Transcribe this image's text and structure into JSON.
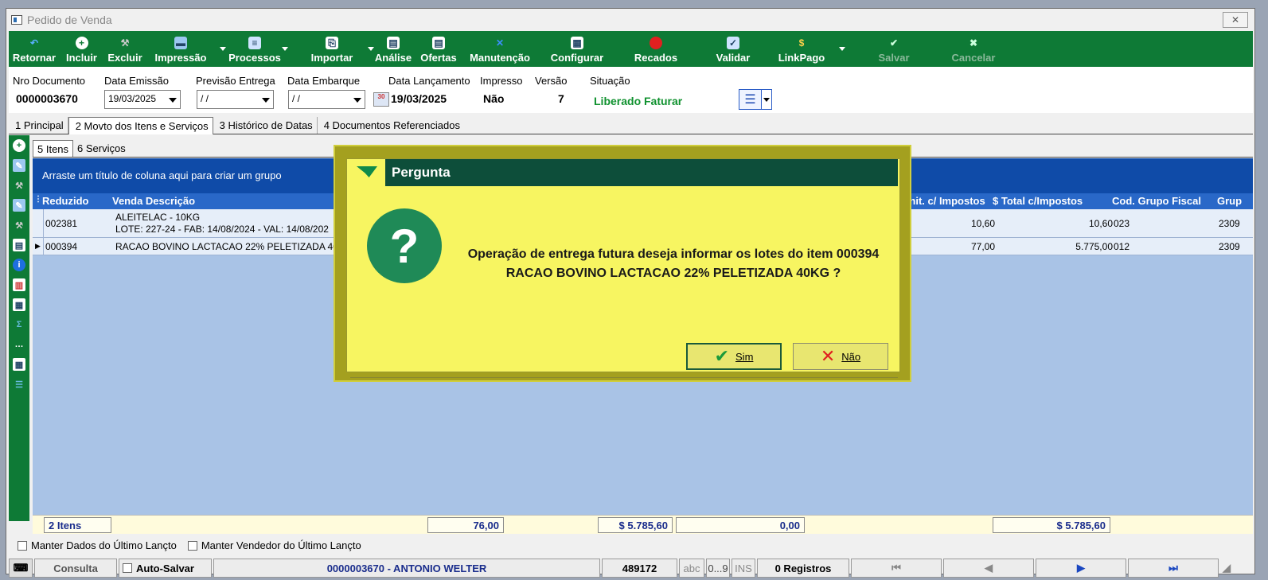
{
  "window": {
    "title": "Pedido de Venda",
    "close_icon": "close-icon"
  },
  "toolbar": {
    "items": [
      {
        "label": "Retornar",
        "icon": "return-icon"
      },
      {
        "label": "Incluir",
        "icon": "plus-icon"
      },
      {
        "label": "Excluir",
        "icon": "delete-icon"
      },
      {
        "label": "Impressão",
        "icon": "printer-icon"
      },
      {
        "label": "Processos",
        "icon": "document-icon"
      },
      {
        "label": "Importar",
        "icon": "import-icon"
      },
      {
        "label": "Análise",
        "icon": "analysis-icon"
      },
      {
        "label": "Ofertas",
        "icon": "offers-icon"
      },
      {
        "label": "Manutenção",
        "icon": "tools-icon"
      },
      {
        "label": "Configurar",
        "icon": "configure-icon"
      },
      {
        "label": "Recados",
        "icon": "message-icon"
      },
      {
        "label": "Validar",
        "icon": "validate-icon"
      },
      {
        "label": "LinkPago",
        "icon": "money-bag-icon"
      },
      {
        "label": "Salvar",
        "icon": "check-icon"
      },
      {
        "label": "Cancelar",
        "icon": "cancel-icon"
      }
    ]
  },
  "header": {
    "nro_documento_label": "Nro Documento",
    "nro_documento": "0000003670",
    "data_emissao_label": "Data Emissão",
    "data_emissao": "19/03/2025",
    "previsao_entrega_label": "Previsão Entrega",
    "previsao_entrega": "/ /",
    "data_embarque_label": "Data Embarque",
    "data_embarque": "/ /",
    "data_lancamento_label": "Data Lançamento",
    "data_lancamento": "19/03/2025",
    "impresso_label": "Impresso",
    "impresso": "Não",
    "versao_label": "Versão",
    "versao": "7",
    "situacao_label": "Situação",
    "situacao": "Liberado Faturar"
  },
  "tabs": [
    "1 Principal",
    "2 Movto dos Itens e Serviços",
    "3 Histórico de Datas",
    "4 Documentos Referenciados"
  ],
  "subtabs": [
    "5 Itens",
    "6 Serviços"
  ],
  "grid": {
    "group_hint": "Arraste um título de coluna aqui para criar um grupo",
    "columns": [
      "Reduzido",
      "Venda Descrição",
      "Unit. c/ Impostos",
      "$ Total c/Impostos",
      "Cod. Grupo Fiscal",
      "Grup"
    ],
    "rows": [
      {
        "reduzido": "002381",
        "descricao": "ALEITELAC - 10KG",
        "lote": "LOTE:  227-24 - FAB:  14/08/2024 - VAL:  14/08/202",
        "unit": "10,60",
        "total": "10,60",
        "grupo_fiscal": "023",
        "grup": "2309"
      },
      {
        "reduzido": "000394",
        "descricao": "RACAO BOVINO LACTACAO 22% PELETIZADA 40K",
        "unit": "77,00",
        "total": "5.775,00",
        "grupo_fiscal": "012",
        "grup": "2309"
      }
    ]
  },
  "footer": {
    "itens": "2 Itens",
    "qtd": "76,00",
    "total": "$ 5.785,60",
    "desconto": "0,00",
    "total2": "$ 5.785,60"
  },
  "checks": {
    "manter_dados": "Manter Dados do Último Lançto",
    "manter_vendedor": "Manter Vendedor do Último Lançto"
  },
  "status": {
    "mode": "Consulta",
    "auto_salvar": "Auto-Salvar",
    "cliente": "0000003670 - ANTONIO WELTER",
    "codigo": "489172",
    "abc": "abc",
    "num": "0...9",
    "ins": "INS",
    "registros": "0 Registros"
  },
  "dialog": {
    "title": "Pergunta",
    "message_line1": "Operação de entrega futura deseja informar os lotes do item 000394",
    "message_line2": "RACAO BOVINO LACTACAO 22% PELETIZADA 40KG ?",
    "yes": "Sim",
    "no": "Não"
  },
  "colors": {
    "toolbar": "#0e7a36",
    "grid_header": "#2968c8",
    "dialog_bg": "#f7f561",
    "dialog_title": "#0d4e3a",
    "situacao": "#10922f"
  }
}
